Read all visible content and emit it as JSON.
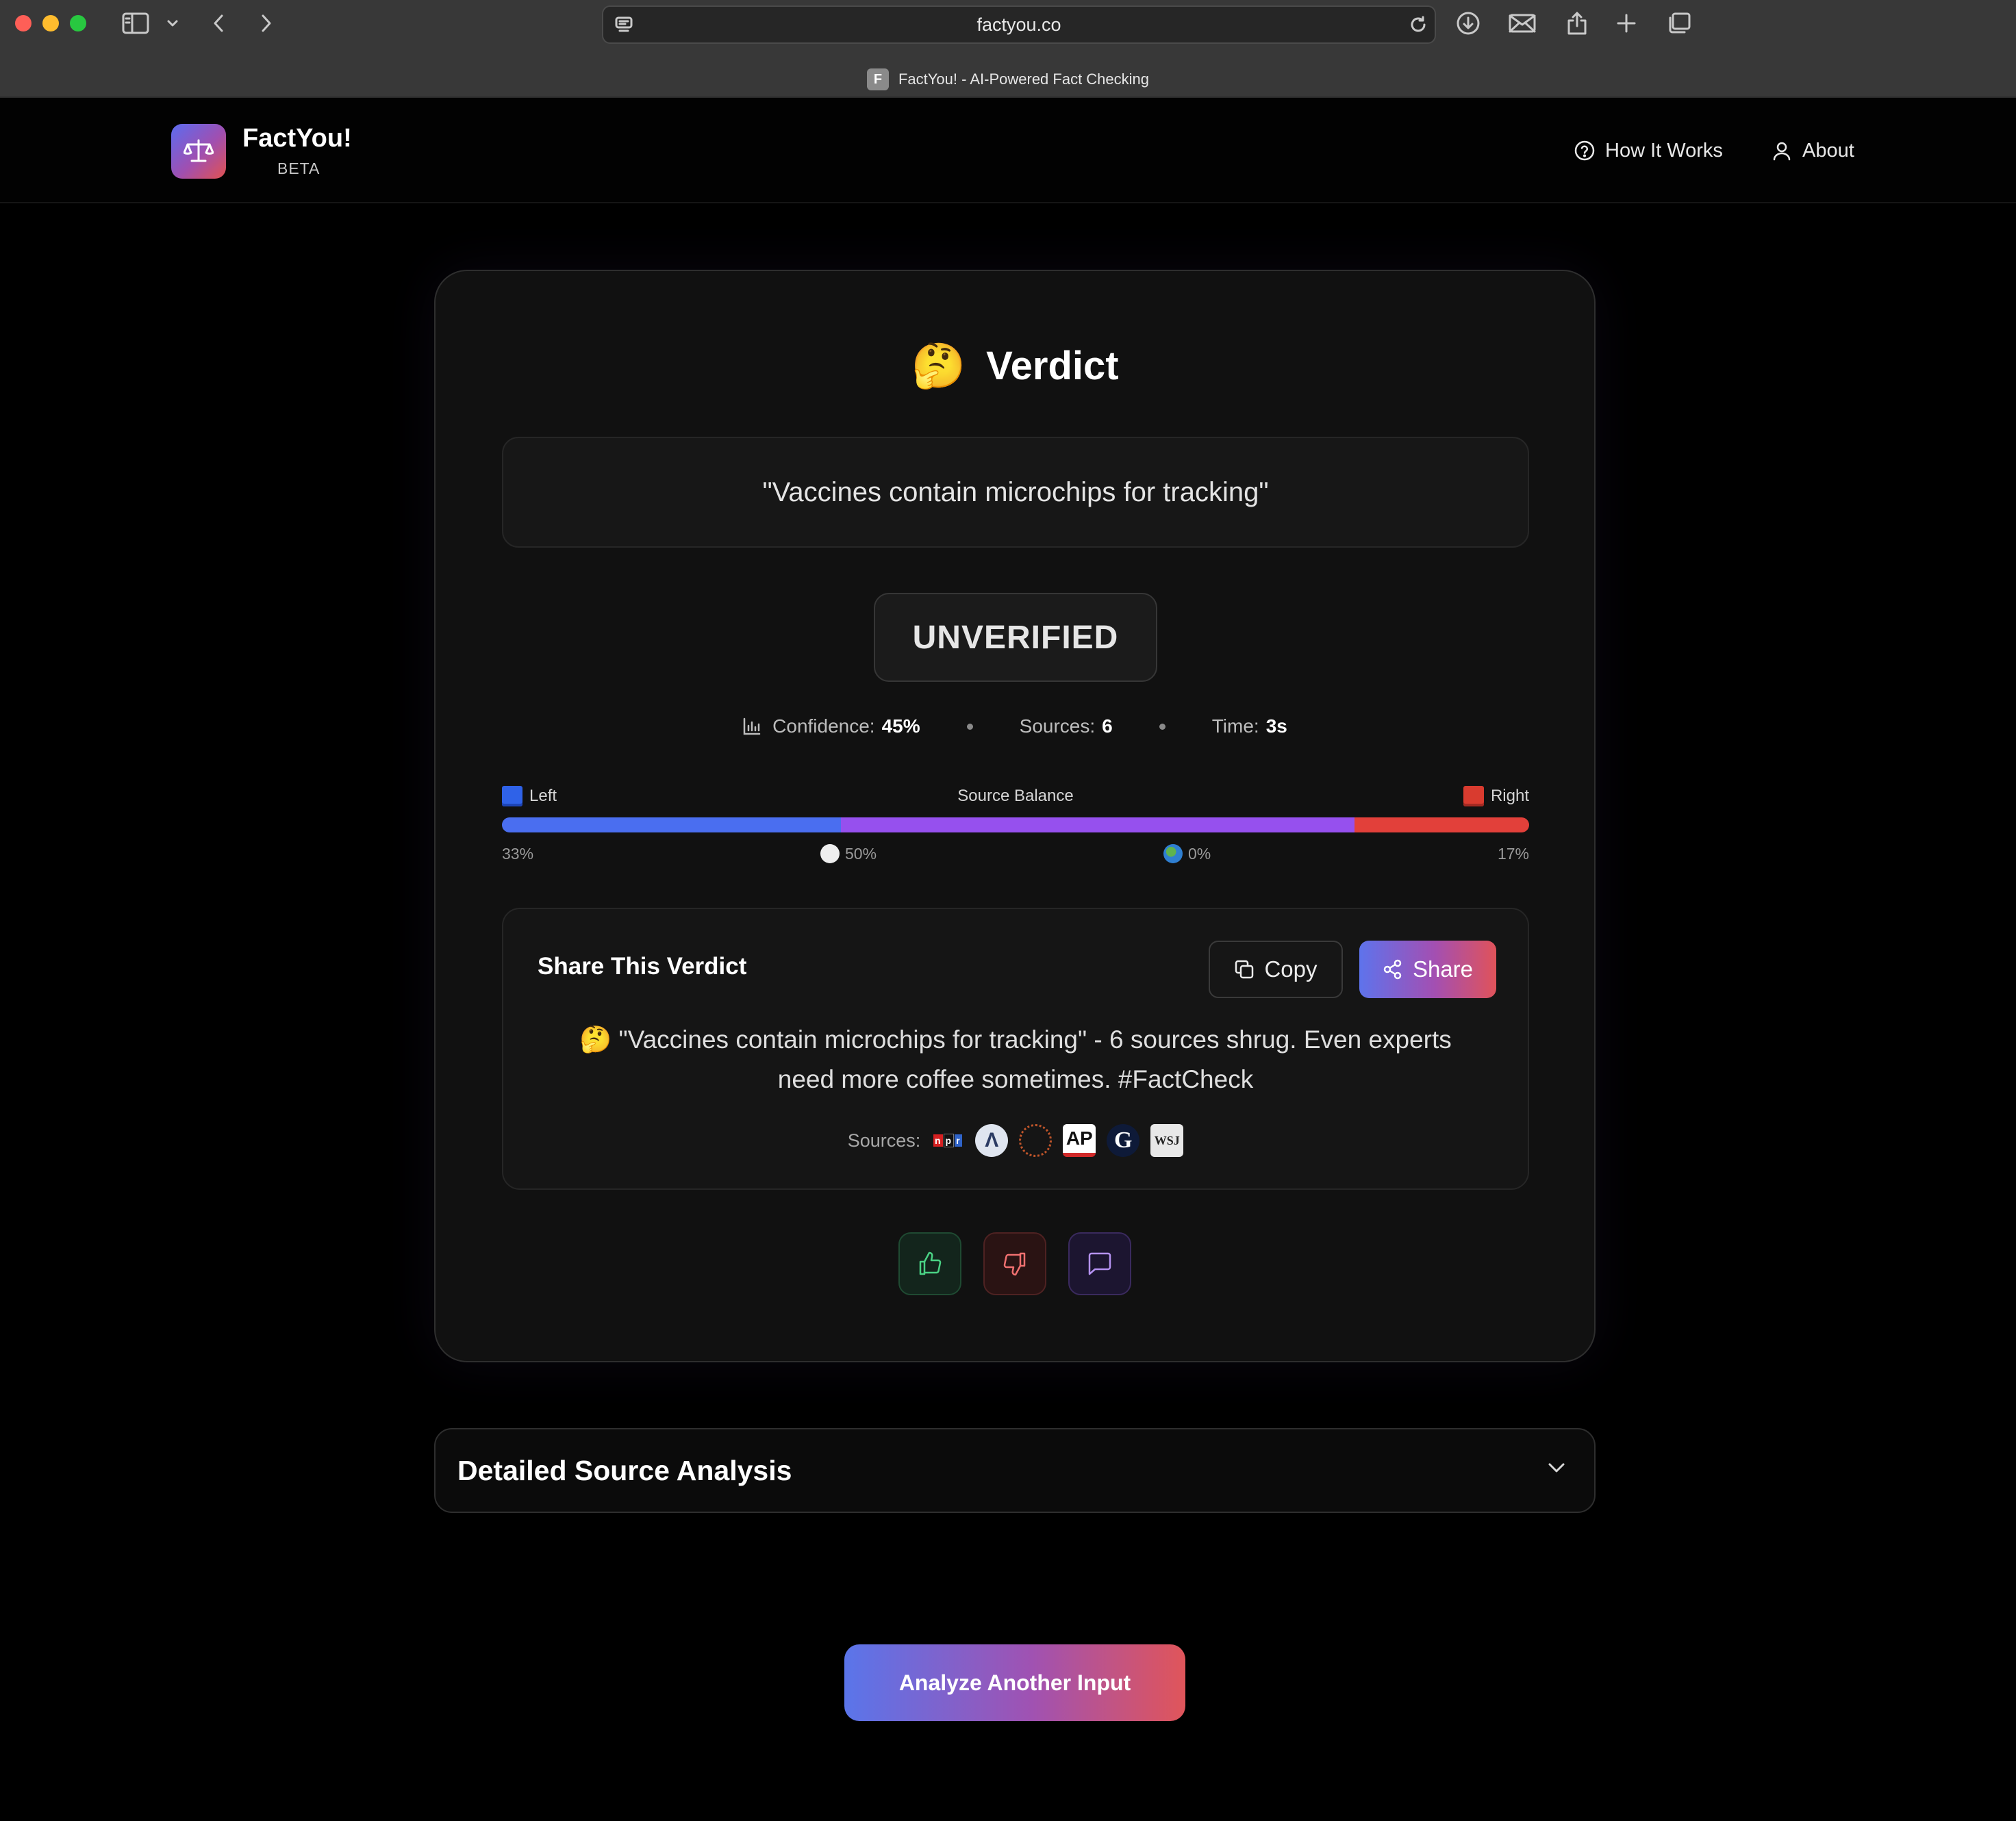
{
  "browser": {
    "url": "factyou.co",
    "tab_favicon": "F",
    "tab_title": "FactYou! - AI-Powered Fact Checking",
    "icons": [
      "sidebar-icon",
      "chevron-down-icon",
      "back-arrow-icon",
      "forward-arrow-icon",
      "page-settings-icon",
      "reload-icon",
      "download-icon",
      "mail-icon",
      "share-icon",
      "new-tab-icon",
      "tab-overview-icon"
    ]
  },
  "header": {
    "brand": "FactYou!",
    "badge": "BETA",
    "logo_icon": "scale-icon",
    "nav": [
      {
        "label": "How It Works",
        "icon": "help-circle-icon"
      },
      {
        "label": "About",
        "icon": "user-icon"
      }
    ]
  },
  "verdict": {
    "emoji": "🤔",
    "title": "Verdict",
    "claim": "\"Vaccines contain microchips for tracking\"",
    "status": "UNVERIFIED",
    "stats": {
      "confidence_label": "Confidence:",
      "confidence_value": "45%",
      "sources_label": "Sources:",
      "sources_value": "6",
      "time_label": "Time:",
      "time_value": "3s"
    },
    "balance": {
      "title": "Source Balance",
      "left_label": "Left",
      "right_label": "Right",
      "left_pct": "33%",
      "center_pct": "50%",
      "intl_pct": "0%",
      "right_pct": "17%",
      "left_value": 33,
      "center_value": 50,
      "right_value": 17,
      "left_color": "#4a6ef0",
      "center_color": "#9650ee",
      "right_color": "#e2403a"
    }
  },
  "share": {
    "title": "Share This Verdict",
    "copy_label": "Copy",
    "share_label": "Share",
    "emoji": "🤔",
    "text": "\"Vaccines contain microchips for tracking\" - 6 sources shrug. Even experts need more coffee sometimes. #FactCheck",
    "sources_label": "Sources:",
    "source_logos": [
      "npr-logo",
      "axios-logo",
      "ring-logo",
      "ap-logo",
      "guardian-logo",
      "wsj-logo"
    ],
    "logo_text": {
      "npr": [
        "n",
        "p",
        "r"
      ],
      "axios": "Λ",
      "ap": "AP",
      "guardian": "G",
      "wsj": "WSJ"
    }
  },
  "feedback": {
    "icons": [
      "thumbs-up-icon",
      "thumbs-down-icon",
      "comment-icon"
    ]
  },
  "details": {
    "title": "Detailed Source Analysis"
  },
  "actions": {
    "analyze_label": "Analyze Another Input"
  }
}
